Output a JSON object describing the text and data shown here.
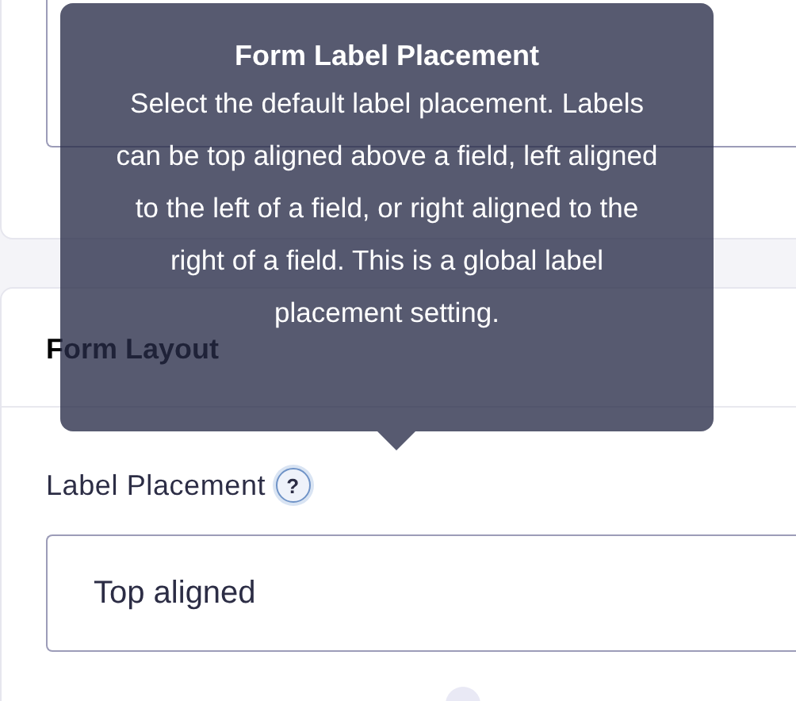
{
  "section": {
    "title": "Form Layout"
  },
  "field": {
    "label": "Label Placement",
    "help": "?",
    "value": "Top aligned"
  },
  "tooltip": {
    "title": "Form Label Placement",
    "text": "Select the default label placement. Labels can be top aligned above a field, left aligned to the left of a field, or right aligned to the right of a field. This is a global label placement setting."
  }
}
